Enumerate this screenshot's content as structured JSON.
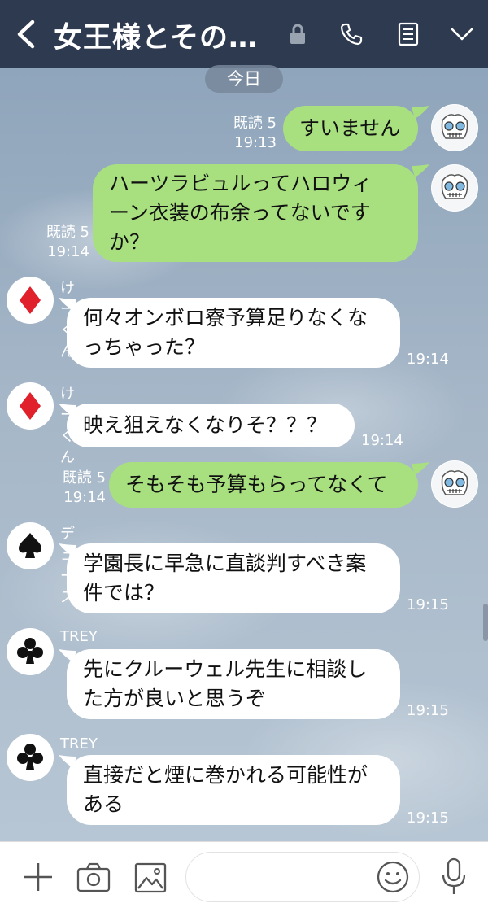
{
  "header": {
    "title": "女王様とその…",
    "back_icon": "chevron-left-icon",
    "icons": [
      "lock-icon",
      "phone-icon",
      "notes-icon",
      "chevron-down-icon"
    ]
  },
  "date_label": "今日",
  "messages": [
    {
      "side": "me",
      "text": "すいません",
      "read": "既読 5",
      "time": "19:13"
    },
    {
      "side": "me",
      "text": "ハーツラビュルってハロウィーン衣装の布余ってないですか？",
      "lines": [
        "ハーツラビュルってハロウィ",
        "ーン衣装の布余ってないです",
        "か？"
      ],
      "read": "既読 5",
      "time": "19:14"
    },
    {
      "side": "them",
      "sender": "けーくん",
      "avatar": "diamond-icon",
      "lines": [
        "何々オンボロ寮予算足りなくな",
        "っちゃった？"
      ],
      "time": "19:14"
    },
    {
      "side": "them",
      "sender": "けーくん",
      "avatar": "diamond-icon",
      "lines": [
        "映え狙えなくなりそ？？？"
      ],
      "time": "19:14"
    },
    {
      "side": "me",
      "text": "そもそも予算もらってなくて",
      "read": "既読 5",
      "time": "19:14"
    },
    {
      "side": "them",
      "sender": "デュース",
      "avatar": "spade-icon",
      "lines": [
        "学園長に早急に直談判すべき案",
        "件では？"
      ],
      "time": "19:15"
    },
    {
      "side": "them",
      "sender": "TREY",
      "avatar": "club-icon",
      "lines": [
        "先にクルーウェル先生に相談し",
        "た方が良いと思うぞ"
      ],
      "time": "19:15"
    },
    {
      "side": "them",
      "sender": "TREY",
      "avatar": "club-icon",
      "lines": [
        "直接だと煙に巻かれる可能性が",
        "ある"
      ],
      "time": "19:15"
    }
  ],
  "input": {
    "placeholder": "",
    "icons": [
      "plus-icon",
      "camera-icon",
      "image-icon",
      "emoji-icon",
      "microphone-icon"
    ]
  },
  "colors": {
    "header_bg": "#2e3a4f",
    "my_bubble": "#a8e07f",
    "their_bubble": "#ffffff",
    "diamond": "#e0202a"
  }
}
